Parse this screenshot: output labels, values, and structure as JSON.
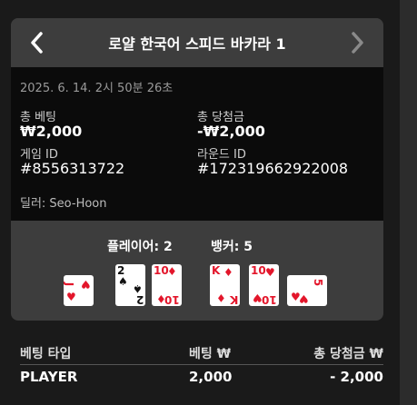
{
  "header": {
    "title": "로얄 한국어 스피드 바카라 1"
  },
  "round": {
    "datetime": "2025. 6. 14. 2시 50분 26초",
    "bet_label": "총 베팅",
    "bet_value": "₩2,000",
    "win_label": "총 당첨금",
    "win_value": "-₩2,000",
    "game_id_label": "게임 ID",
    "game_id_value": "#8556313722",
    "round_id_label": "라운드 ID",
    "round_id_value": "#172319662922008",
    "dealer": "딜러: Seo-Hoon"
  },
  "result": {
    "player_score": "플레이어: 2",
    "banker_score": "뱅커: 5",
    "player_cards": [
      {
        "rank": "J",
        "suit": "♥",
        "color": "#e3162b"
      },
      {
        "rank": "2",
        "suit": "♠",
        "color": "#111111"
      },
      {
        "rank": "10",
        "suit": "♦",
        "color": "#e3162b"
      }
    ],
    "banker_cards": [
      {
        "rank": "K",
        "suit": "♦",
        "color": "#e3162b"
      },
      {
        "rank": "10",
        "suit": "♥",
        "color": "#e3162b"
      },
      {
        "rank": "5",
        "suit": "♥",
        "color": "#e3162b"
      }
    ]
  },
  "table": {
    "headers": [
      "베팅 타입",
      "베팅 ₩",
      "총 당첨금 ₩"
    ],
    "rows": [
      [
        "PLAYER",
        "2,000",
        "- 2,000"
      ]
    ]
  }
}
